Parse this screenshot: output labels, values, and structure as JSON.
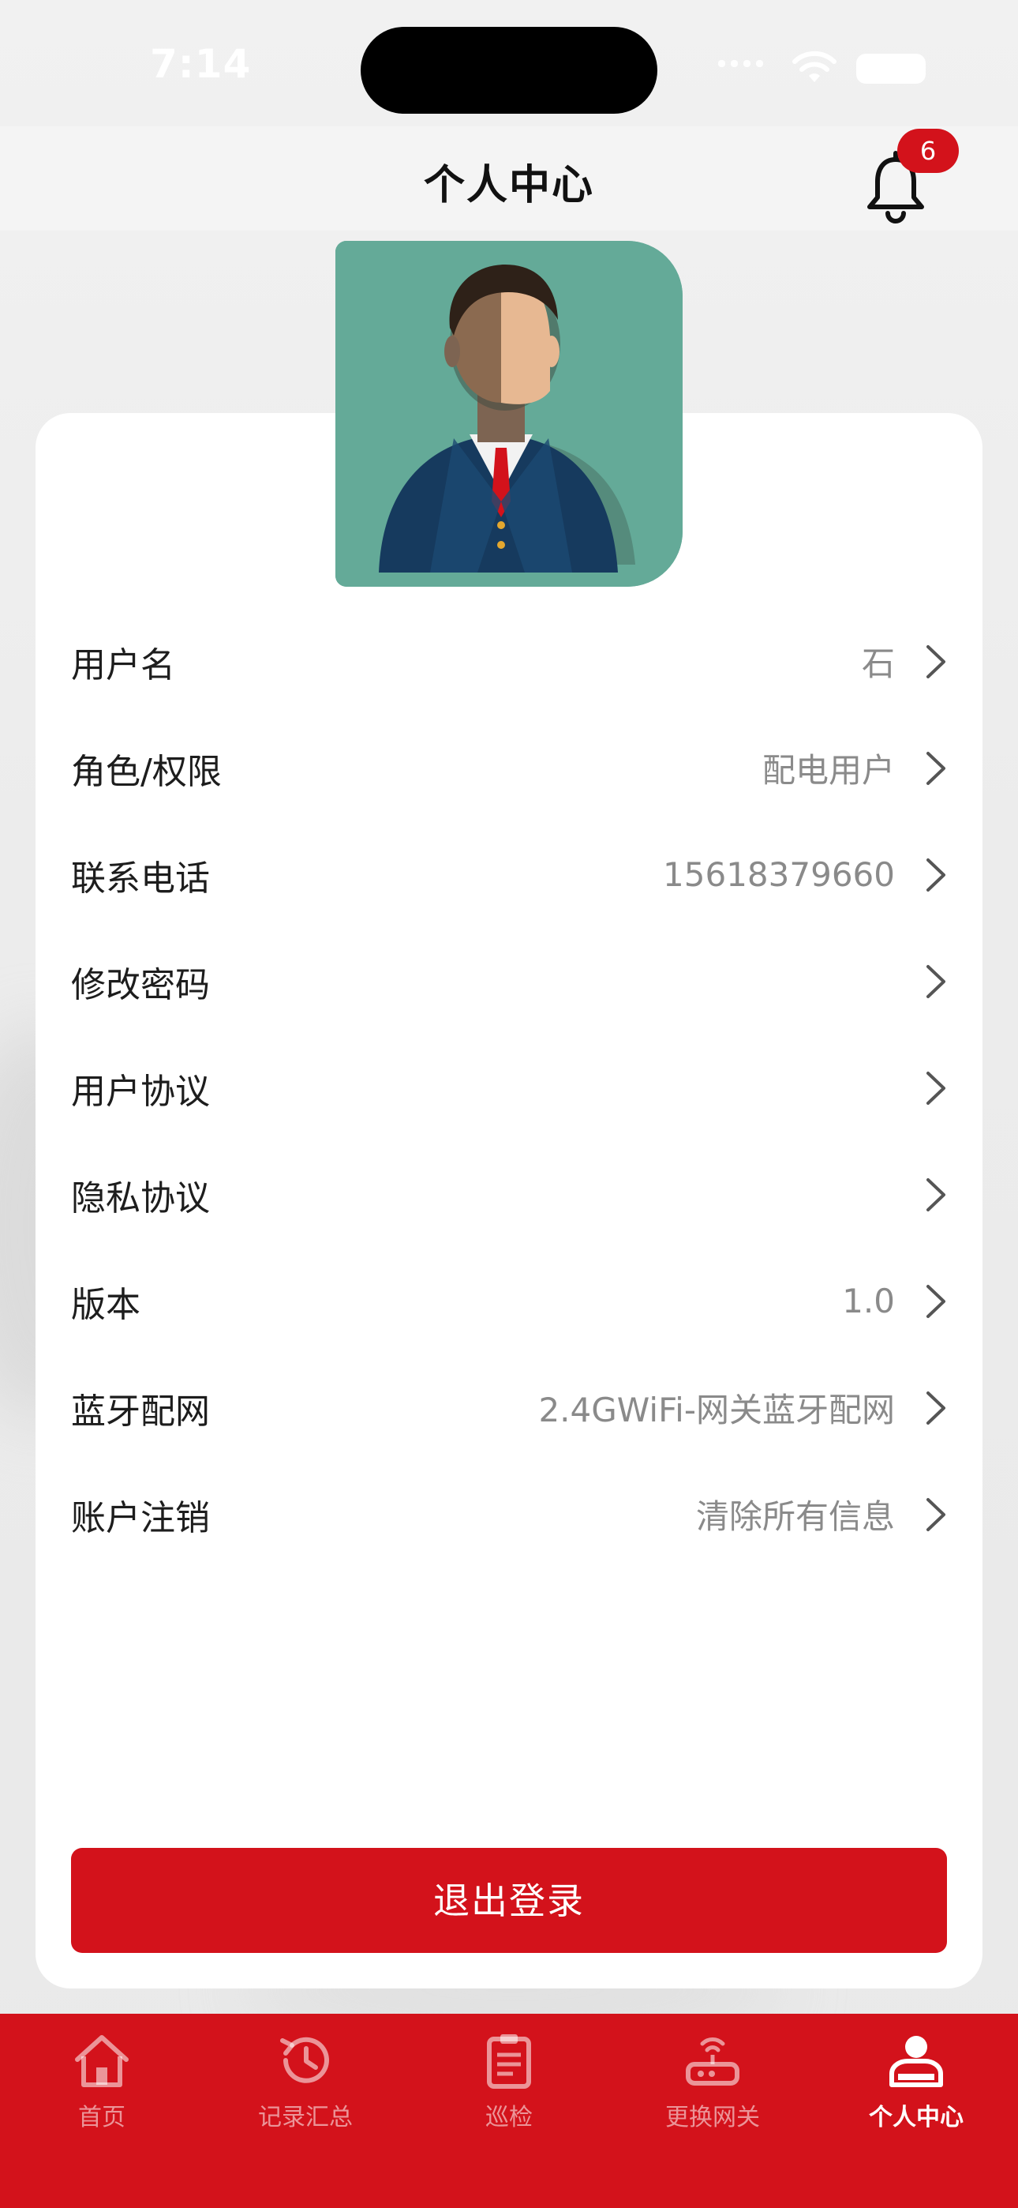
{
  "status_bar": {
    "time": "7:14"
  },
  "header": {
    "title": "个人中心",
    "notification_count": "6"
  },
  "profile": {
    "rows": [
      {
        "label": "用户名",
        "value": "石"
      },
      {
        "label": "角色/权限",
        "value": "配电用户"
      },
      {
        "label": "联系电话",
        "value": "15618379660"
      },
      {
        "label": "修改密码",
        "value": ""
      },
      {
        "label": "用户协议",
        "value": ""
      },
      {
        "label": "隐私协议",
        "value": ""
      },
      {
        "label": "版本",
        "value": "1.0"
      },
      {
        "label": "蓝牙配网",
        "value": "2.4GWiFi-网关蓝牙配网"
      },
      {
        "label": "账户注销",
        "value": "清除所有信息"
      }
    ],
    "logout_label": "退出登录"
  },
  "tabbar": {
    "items": [
      {
        "label": "首页",
        "icon": "home-icon",
        "active": false
      },
      {
        "label": "记录汇总",
        "icon": "history-icon",
        "active": false
      },
      {
        "label": "巡检",
        "icon": "clipboard-icon",
        "active": false
      },
      {
        "label": "更换网关",
        "icon": "router-icon",
        "active": false
      },
      {
        "label": "个人中心",
        "icon": "user-icon",
        "active": true
      }
    ]
  },
  "colors": {
    "accent": "#d3121b",
    "avatar_bg": "#64aa98"
  }
}
